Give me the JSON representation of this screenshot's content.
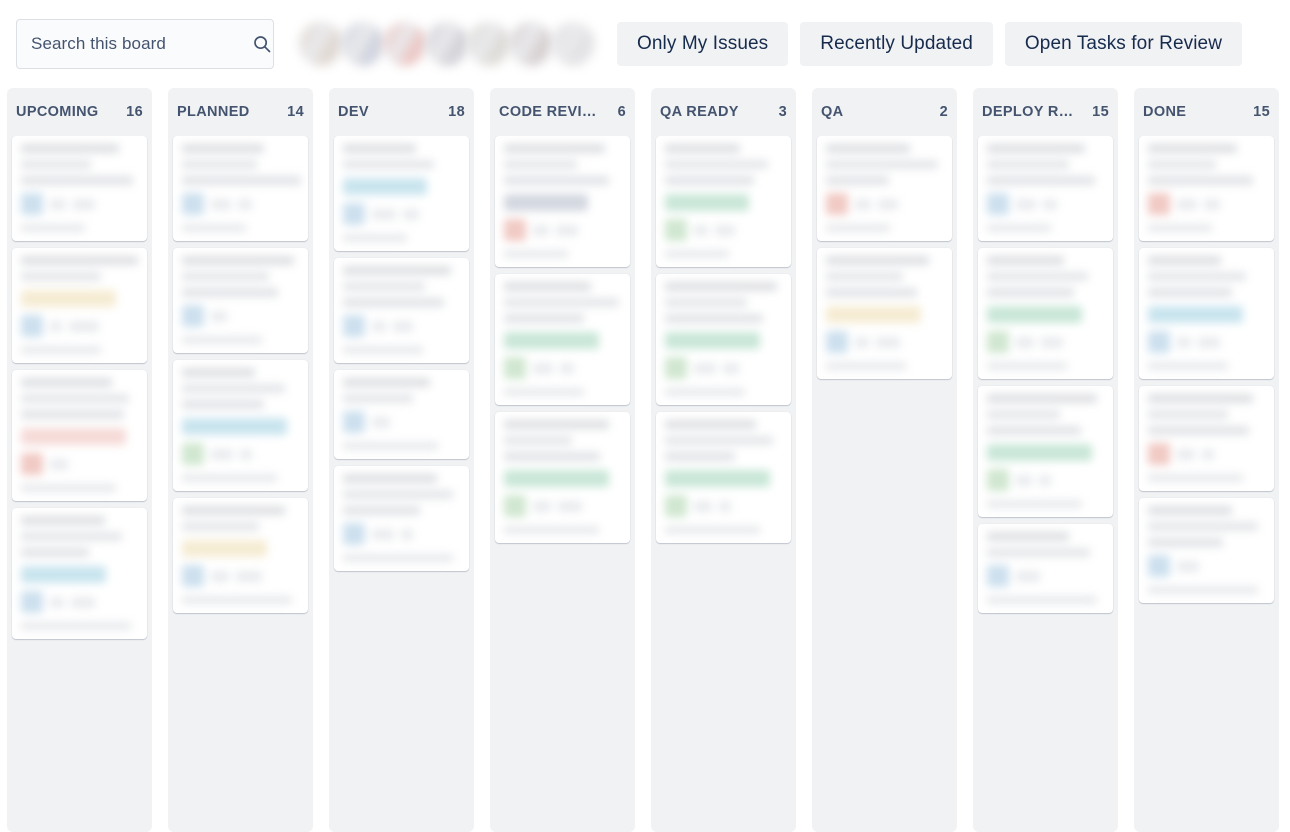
{
  "search": {
    "placeholder": "Search this board",
    "value": "",
    "icon": "search-icon"
  },
  "avatars": [
    {
      "name": "avatar-1",
      "color": "#d9cfc6"
    },
    {
      "name": "avatar-2",
      "color": "#c3c8d6"
    },
    {
      "name": "avatar-3",
      "color": "#e8b8b4"
    },
    {
      "name": "avatar-4",
      "color": "#c6c6ce"
    },
    {
      "name": "avatar-5",
      "color": "#d6d3cd"
    },
    {
      "name": "avatar-6",
      "color": "#cdc4c4"
    },
    {
      "name": "avatar-7",
      "color": "#dcdcdf"
    }
  ],
  "filters": [
    {
      "label": "Only My Issues"
    },
    {
      "label": "Recently Updated"
    },
    {
      "label": "Open Tasks for Review"
    }
  ],
  "colors": {
    "accent_text": "#172b4d",
    "muted_text": "#44546f",
    "column_bg": "#f1f2f4",
    "card_bg": "#ffffff",
    "chip_blue": "#a8d4e4",
    "chip_green": "#a8d8c0",
    "chip_amber": "#f0e0b8",
    "chip_red": "#f0c4c0",
    "chip_gray": "#b8bfcc"
  },
  "columns": [
    {
      "title": "UPCOMING",
      "count": "16",
      "cards": [
        {
          "lines": [
            84,
            60,
            96
          ],
          "chip": null,
          "avatar": "#aecde4",
          "badges": [
            16,
            22
          ]
        },
        {
          "lines": [
            100,
            68,
            0
          ],
          "chip": "#f0e0b8",
          "avatar": "#aecde4",
          "badges": [
            12,
            30
          ]
        },
        {
          "lines": [
            78,
            92,
            88
          ],
          "chip": "#f0c4c0",
          "avatar": "#e8a9a0",
          "badges": [
            18
          ]
        },
        {
          "lines": [
            72,
            86,
            58
          ],
          "chip": "#a8d4e4",
          "avatar": "#aecde4",
          "badges": [
            14,
            24
          ]
        }
      ]
    },
    {
      "title": "PLANNED",
      "count": "14",
      "cards": [
        {
          "lines": [
            70,
            64,
            102
          ],
          "chip": null,
          "avatar": "#aecde4",
          "badges": [
            20,
            14
          ]
        },
        {
          "lines": [
            96,
            74,
            82
          ],
          "chip": null,
          "avatar": "#aecde4",
          "badges": [
            16
          ]
        },
        {
          "lines": [
            62,
            88,
            70
          ],
          "chip": "#a8d4e4",
          "avatar": "#b4d8b4",
          "badges": [
            22,
            12
          ]
        },
        {
          "lines": [
            88,
            66,
            0
          ],
          "chip": "#f0e0b8",
          "avatar": "#aecde4",
          "badges": [
            18,
            26
          ]
        }
      ]
    },
    {
      "title": "DEV",
      "count": "18",
      "cards": [
        {
          "lines": [
            62,
            78,
            0
          ],
          "chip": "#a8d4e4",
          "avatar": "#aecde4",
          "badges": [
            24,
            16
          ]
        },
        {
          "lines": [
            92,
            70,
            86
          ],
          "chip": null,
          "avatar": "#aecde4",
          "badges": [
            14,
            20
          ]
        },
        {
          "lines": [
            74,
            60,
            0
          ],
          "chip": null,
          "avatar": "#aecde4",
          "badges": [
            18
          ]
        },
        {
          "lines": [
            80,
            94,
            66
          ],
          "chip": null,
          "avatar": "#aecde4",
          "badges": [
            22,
            12
          ]
        }
      ]
    },
    {
      "title": "CODE REVIEW",
      "count": "6",
      "cards": [
        {
          "lines": [
            86,
            62,
            90
          ],
          "chip": "#b8bfcc",
          "avatar": "#e8a9a0",
          "badges": [
            16,
            22
          ]
        },
        {
          "lines": [
            74,
            98,
            68
          ],
          "chip": "#a8d8c0",
          "avatar": "#b4d8b4",
          "badges": [
            20,
            14
          ]
        },
        {
          "lines": [
            90,
            58,
            82
          ],
          "chip": "#a8d8c0",
          "avatar": "#b4d8b4",
          "badges": [
            18,
            24
          ]
        }
      ]
    },
    {
      "title": "QA READY",
      "count": "3",
      "cards": [
        {
          "lines": [
            64,
            88,
            76
          ],
          "chip": "#a8d8c0",
          "avatar": "#b4d8b4",
          "badges": [
            14,
            20
          ]
        },
        {
          "lines": [
            96,
            70,
            84
          ],
          "chip": "#a8d8c0",
          "avatar": "#b4d8b4",
          "badges": [
            22,
            16
          ]
        },
        {
          "lines": [
            78,
            92,
            60
          ],
          "chip": "#a8d8c0",
          "avatar": "#b4d8b4",
          "badges": [
            18,
            12
          ]
        }
      ]
    },
    {
      "title": "QA",
      "count": "2",
      "cards": [
        {
          "lines": [
            72,
            96,
            54
          ],
          "chip": null,
          "avatar": "#e8a9a0",
          "badges": [
            16,
            20
          ]
        },
        {
          "lines": [
            88,
            66,
            78
          ],
          "chip": "#f0e0b8",
          "avatar": "#aecde4",
          "badges": [
            14,
            24
          ]
        }
      ]
    },
    {
      "title": "DEPLOY READY",
      "count": "15",
      "cards": [
        {
          "lines": [
            84,
            70,
            92
          ],
          "chip": null,
          "avatar": "#aecde4",
          "badges": [
            20,
            14
          ]
        },
        {
          "lines": [
            66,
            86,
            74
          ],
          "chip": "#a8d8c0",
          "avatar": "#b4d8b4",
          "badges": [
            18,
            22
          ]
        },
        {
          "lines": [
            94,
            62,
            80
          ],
          "chip": "#a8d8c0",
          "avatar": "#b4d8b4",
          "badges": [
            16,
            12
          ]
        },
        {
          "lines": [
            70,
            88,
            0
          ],
          "chip": null,
          "avatar": "#aecde4",
          "badges": [
            24
          ]
        }
      ]
    },
    {
      "title": "DONE",
      "count": "15",
      "cards": [
        {
          "lines": [
            76,
            58,
            90
          ],
          "chip": null,
          "avatar": "#e8a9a0",
          "badges": [
            20,
            16
          ]
        },
        {
          "lines": [
            62,
            84,
            72
          ],
          "chip": "#a8d4e4",
          "avatar": "#aecde4",
          "badges": [
            14,
            22
          ]
        },
        {
          "lines": [
            90,
            68,
            86
          ],
          "chip": null,
          "avatar": "#e8a9a0",
          "badges": [
            18,
            12
          ]
        },
        {
          "lines": [
            72,
            94,
            64
          ],
          "chip": null,
          "avatar": "#aecde4",
          "badges": [
            22
          ]
        }
      ]
    }
  ]
}
